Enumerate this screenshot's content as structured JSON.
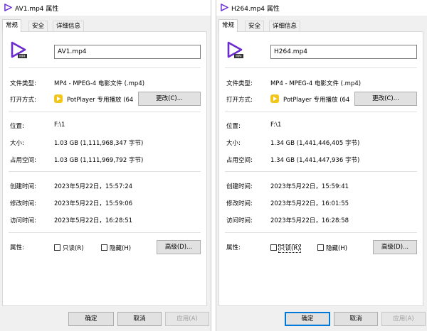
{
  "left": {
    "title": "AV1.mp4 属性",
    "tabs": [
      "常规",
      "安全",
      "详细信息"
    ],
    "file_name": "AV1.mp4",
    "labels": {
      "file_type": "文件类型:",
      "open_with": "打开方式:",
      "location": "位置:",
      "size": "大小:",
      "size_on_disk": "占用空间:",
      "created": "创建时间:",
      "modified": "修改时间:",
      "accessed": "访问时间:",
      "attributes": "属性:"
    },
    "file_type": "MP4 - MPEG-4 电影文件 (.mp4)",
    "open_with_app": "PotPlayer 专用播放 (64",
    "change_button": "更改(C)...",
    "location": "F:\\1",
    "size": "1.03 GB (1,111,968,347 字节)",
    "size_on_disk": "1.03 GB (1,111,969,792 字节)",
    "created": "2023年5月22日，15:57:24",
    "modified": "2023年5月22日，15:59:06",
    "accessed": "2023年5月22日，16:28:51",
    "readonly": "只读(R)",
    "hidden": "隐藏(H)",
    "advanced_button": "高级(D)...",
    "ok": "确定",
    "cancel": "取消",
    "apply": "应用(A)"
  },
  "right": {
    "title": "H264.mp4 属性",
    "tabs": [
      "常规",
      "安全",
      "详细信息"
    ],
    "file_name": "H264.mp4",
    "labels": {
      "file_type": "文件类型:",
      "open_with": "打开方式:",
      "location": "位置:",
      "size": "大小:",
      "size_on_disk": "占用空间:",
      "created": "创建时间:",
      "modified": "修改时间:",
      "accessed": "访问时间:",
      "attributes": "属性:"
    },
    "file_type": "MP4 - MPEG-4 电影文件 (.mp4)",
    "open_with_app": "PotPlayer 专用播放 (64",
    "change_button": "更改(C)...",
    "location": "F:\\1",
    "size": "1.34 GB (1,441,446,405 字节)",
    "size_on_disk": "1.34 GB (1,441,447,936 字节)",
    "created": "2023年5月22日，15:59:41",
    "modified": "2023年5月22日，16:01:55",
    "accessed": "2023年5月22日，16:28:58",
    "readonly": "只读(R)",
    "hidden": "隐藏(H)",
    "advanced_button": "高级(D)...",
    "ok": "确定",
    "cancel": "取消",
    "apply": "应用(A)"
  },
  "colors": {
    "icon_purple": "#6a2ccf",
    "potplayer_yellow": "#f2c718",
    "focus_blue": "#0078d7"
  },
  "icons": {
    "title_icon": "video-file-icon",
    "big_icon": "video-file-icon",
    "app_icon": "potplayer-icon"
  }
}
